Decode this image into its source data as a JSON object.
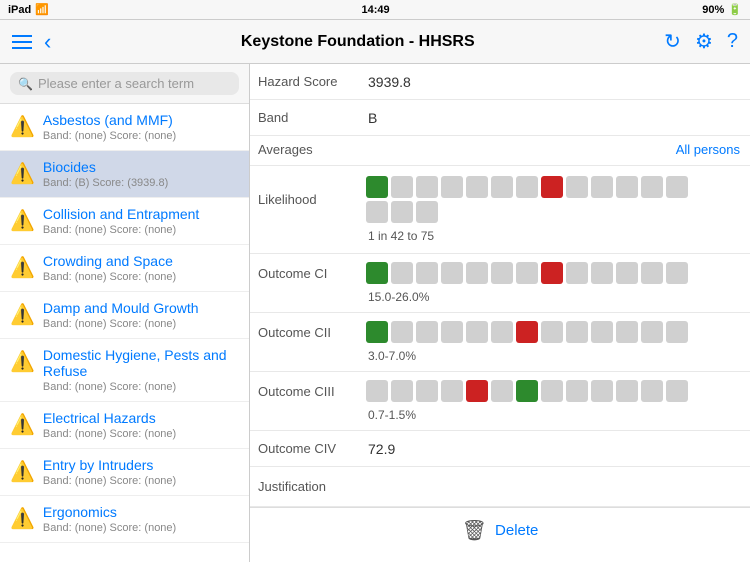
{
  "statusBar": {
    "left": "iPad",
    "time": "14:49",
    "rightItems": [
      "90%"
    ]
  },
  "navBar": {
    "title": "Keystone Foundation - HHSRS",
    "backLabel": "‹",
    "refreshIcon": "↻",
    "settingsIcon": "⚙",
    "helpIcon": "?"
  },
  "search": {
    "placeholder": "Please enter a search term"
  },
  "sidebar": {
    "items": [
      {
        "name": "Asbestos (and MMF)",
        "band": "none",
        "score": "none",
        "selected": false
      },
      {
        "name": "Biocides",
        "band": "B",
        "score": "3939.8",
        "selected": true
      },
      {
        "name": "Collision and Entrapment",
        "band": "none",
        "score": "none",
        "selected": false
      },
      {
        "name": "Crowding and Space",
        "band": "none",
        "score": "none",
        "selected": false
      },
      {
        "name": "Damp and Mould Growth",
        "band": "none",
        "score": "none",
        "selected": false
      },
      {
        "name": "Domestic Hygiene, Pests and Refuse",
        "band": "none",
        "score": "none",
        "selected": false
      },
      {
        "name": "Electrical Hazards",
        "band": "none",
        "score": "none",
        "selected": false
      },
      {
        "name": "Entry by Intruders",
        "band": "none",
        "score": "none",
        "selected": false
      },
      {
        "name": "Ergonomics",
        "band": "none",
        "score": "none",
        "selected": false
      }
    ]
  },
  "content": {
    "hazardScore": {
      "label": "Hazard Score",
      "value": "3939.8"
    },
    "band": {
      "label": "Band",
      "value": "B"
    },
    "averages": {
      "label": "Averages",
      "link": "All persons"
    },
    "likelihood": {
      "label": "Likelihood",
      "range": "1 in 42 to 75",
      "grid": [
        {
          "color": "green"
        },
        {
          "color": "grey"
        },
        {
          "color": "grey"
        },
        {
          "color": "grey"
        },
        {
          "color": "grey"
        },
        {
          "color": "grey"
        },
        {
          "color": "grey"
        },
        {
          "color": "red"
        },
        {
          "color": "grey"
        },
        {
          "color": "grey"
        },
        {
          "color": "grey"
        },
        {
          "color": "grey"
        },
        {
          "color": "grey"
        },
        {
          "color": "grey"
        },
        {
          "color": "grey"
        },
        {
          "color": "grey"
        },
        {
          "color": "empty"
        },
        {
          "color": "empty"
        },
        {
          "color": "empty"
        },
        {
          "color": "empty"
        },
        {
          "color": "empty"
        },
        {
          "color": "empty"
        },
        {
          "color": "empty"
        },
        {
          "color": "empty"
        },
        {
          "color": "empty"
        },
        {
          "color": "empty"
        }
      ]
    },
    "outcomeCi": {
      "label": "Outcome CI",
      "range": "15.0-26.0%",
      "grid": [
        {
          "color": "green"
        },
        {
          "color": "grey"
        },
        {
          "color": "grey"
        },
        {
          "color": "grey"
        },
        {
          "color": "grey"
        },
        {
          "color": "grey"
        },
        {
          "color": "grey"
        },
        {
          "color": "red"
        },
        {
          "color": "grey"
        },
        {
          "color": "grey"
        },
        {
          "color": "grey"
        },
        {
          "color": "grey"
        },
        {
          "color": "grey"
        }
      ]
    },
    "outcomeCii": {
      "label": "Outcome CII",
      "range": "3.0-7.0%",
      "grid": [
        {
          "color": "green"
        },
        {
          "color": "grey"
        },
        {
          "color": "grey"
        },
        {
          "color": "grey"
        },
        {
          "color": "grey"
        },
        {
          "color": "grey"
        },
        {
          "color": "red"
        },
        {
          "color": "grey"
        },
        {
          "color": "grey"
        },
        {
          "color": "grey"
        },
        {
          "color": "grey"
        },
        {
          "color": "grey"
        },
        {
          "color": "grey"
        }
      ]
    },
    "outcomeCiii": {
      "label": "Outcome CIII",
      "range": "0.7-1.5%",
      "grid": [
        {
          "color": "grey"
        },
        {
          "color": "grey"
        },
        {
          "color": "grey"
        },
        {
          "color": "grey"
        },
        {
          "color": "red"
        },
        {
          "color": "grey"
        },
        {
          "color": "green"
        },
        {
          "color": "grey"
        },
        {
          "color": "grey"
        },
        {
          "color": "grey"
        },
        {
          "color": "grey"
        },
        {
          "color": "grey"
        },
        {
          "color": "grey"
        }
      ]
    },
    "outcomeCiv": {
      "label": "Outcome CIV",
      "value": "72.9"
    },
    "justification": {
      "label": "Justification",
      "value": ""
    },
    "deleteButton": "Delete"
  }
}
